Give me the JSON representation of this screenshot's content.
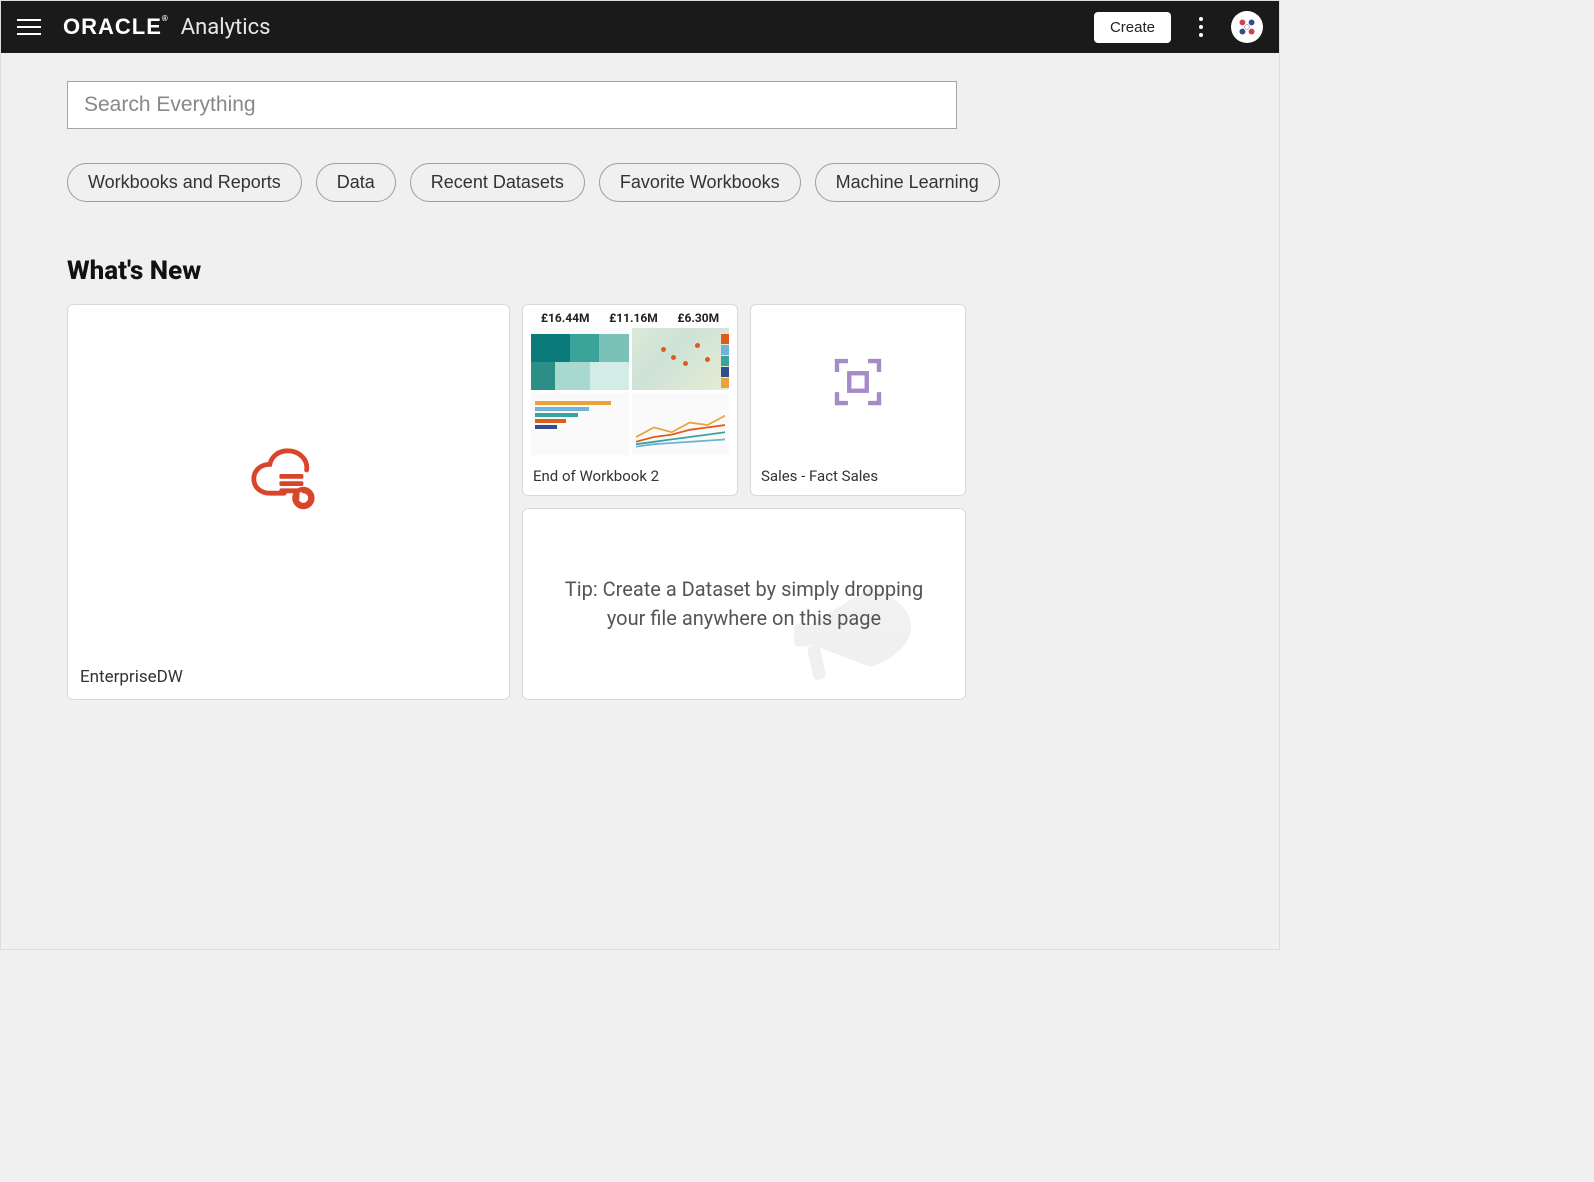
{
  "header": {
    "brand_logo": "ORACLE",
    "brand_sub": "Analytics",
    "create_label": "Create"
  },
  "search": {
    "placeholder": "Search Everything"
  },
  "pills": {
    "p0": "Workbooks and Reports",
    "p1": "Data",
    "p2": "Recent Datasets",
    "p3": "Favorite Workbooks",
    "p4": "Machine Learning"
  },
  "section": {
    "whats_new": "What's New"
  },
  "cards": {
    "enterprise": {
      "label": "EnterpriseDW"
    },
    "workbook2": {
      "label": "End of Workbook 2",
      "metrics": {
        "m0": "£16.44M",
        "m1": "£11.16M",
        "m2": "£6.30M"
      }
    },
    "sales": {
      "label": "Sales - Fact Sales"
    },
    "tip": {
      "text": "Tip: Create a Dataset by simply dropping your file anywhere on this page"
    }
  }
}
